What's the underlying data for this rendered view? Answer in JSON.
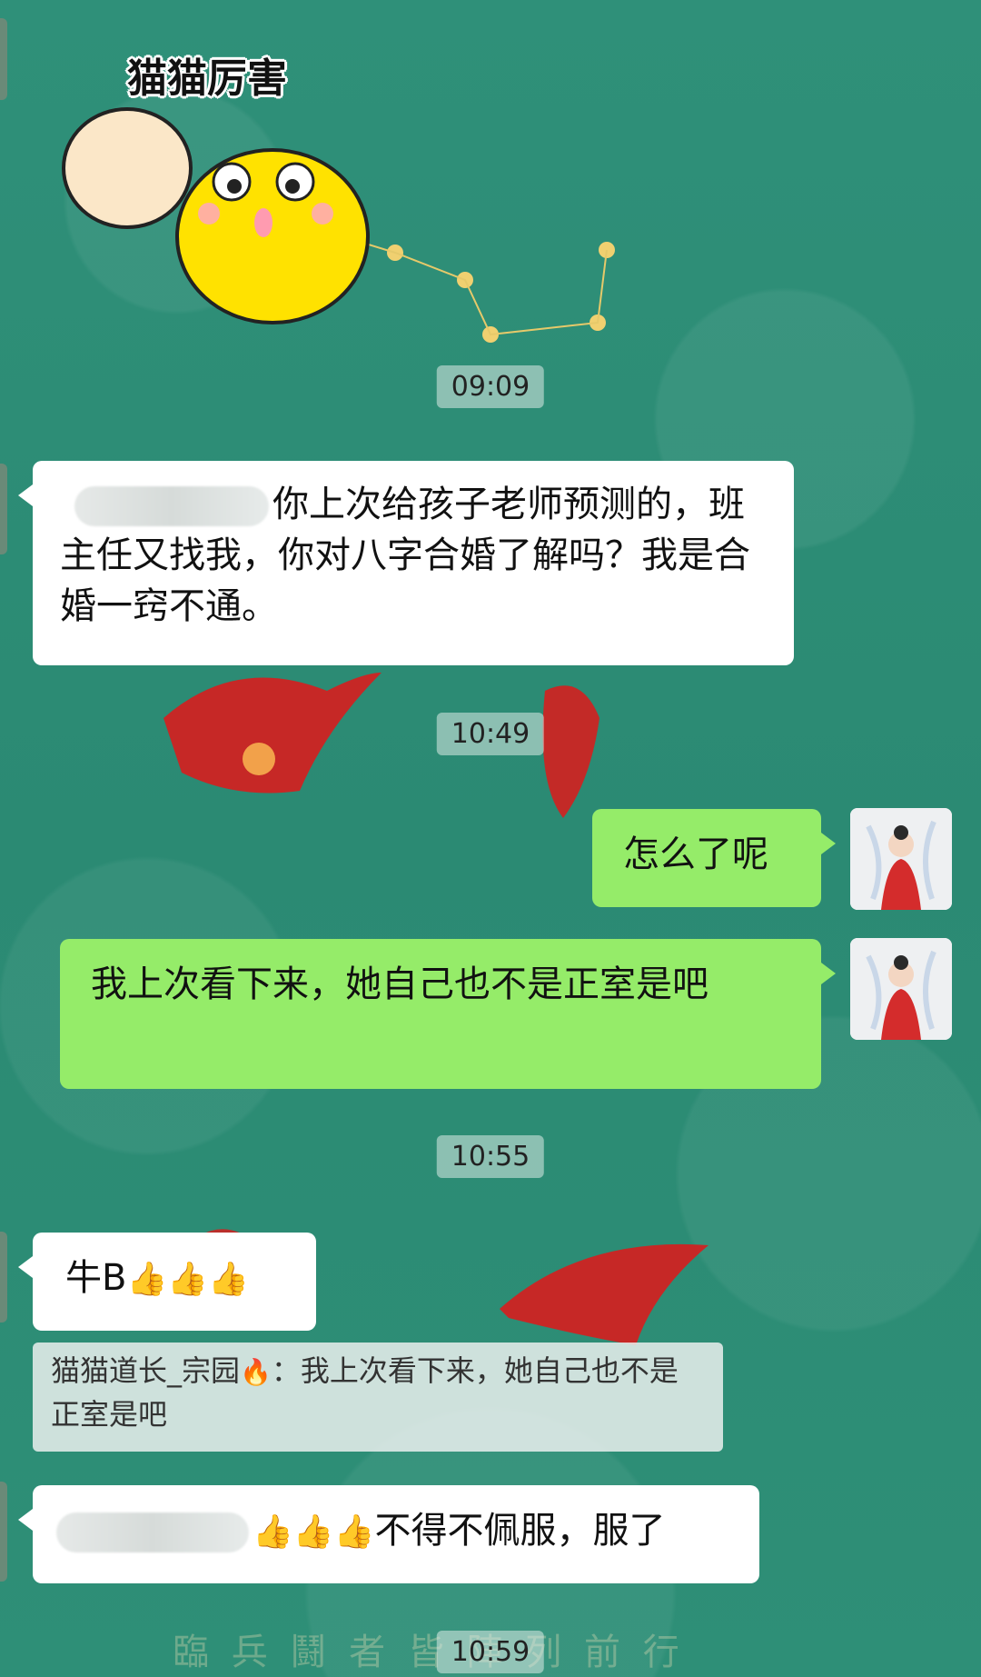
{
  "sticker": {
    "caption": "猫猫厉害"
  },
  "timestamps": [
    "09:09",
    "10:49",
    "10:55",
    "10:59"
  ],
  "messages": {
    "m1": {
      "text": "你上次给孩子老师预测的，班主任又找我，你对八字合婚了解吗？我是合婚一窍不通。"
    },
    "m2": {
      "text": "怎么了呢"
    },
    "m3": {
      "text": "我上次看下来，她自己也不是正室是吧"
    },
    "m4": {
      "text": "牛B",
      "thumbs": "👍👍👍"
    },
    "m5_quote": {
      "sender": "猫猫道长_宗园",
      "fire": "🔥",
      "text": "：我上次看下来，她自己也不是正室是吧"
    },
    "m6": {
      "thumbs": "👍👍👍",
      "text": "不得不佩服，服了"
    }
  },
  "background": {
    "bottom_text": "臨 兵 鬪 者 皆 陣 列 前 行"
  },
  "colors": {
    "chat_bg": "#2f8f78",
    "sent_bubble": "#95ec69",
    "received_bubble": "#ffffff",
    "red_art": "#d41f1f"
  }
}
